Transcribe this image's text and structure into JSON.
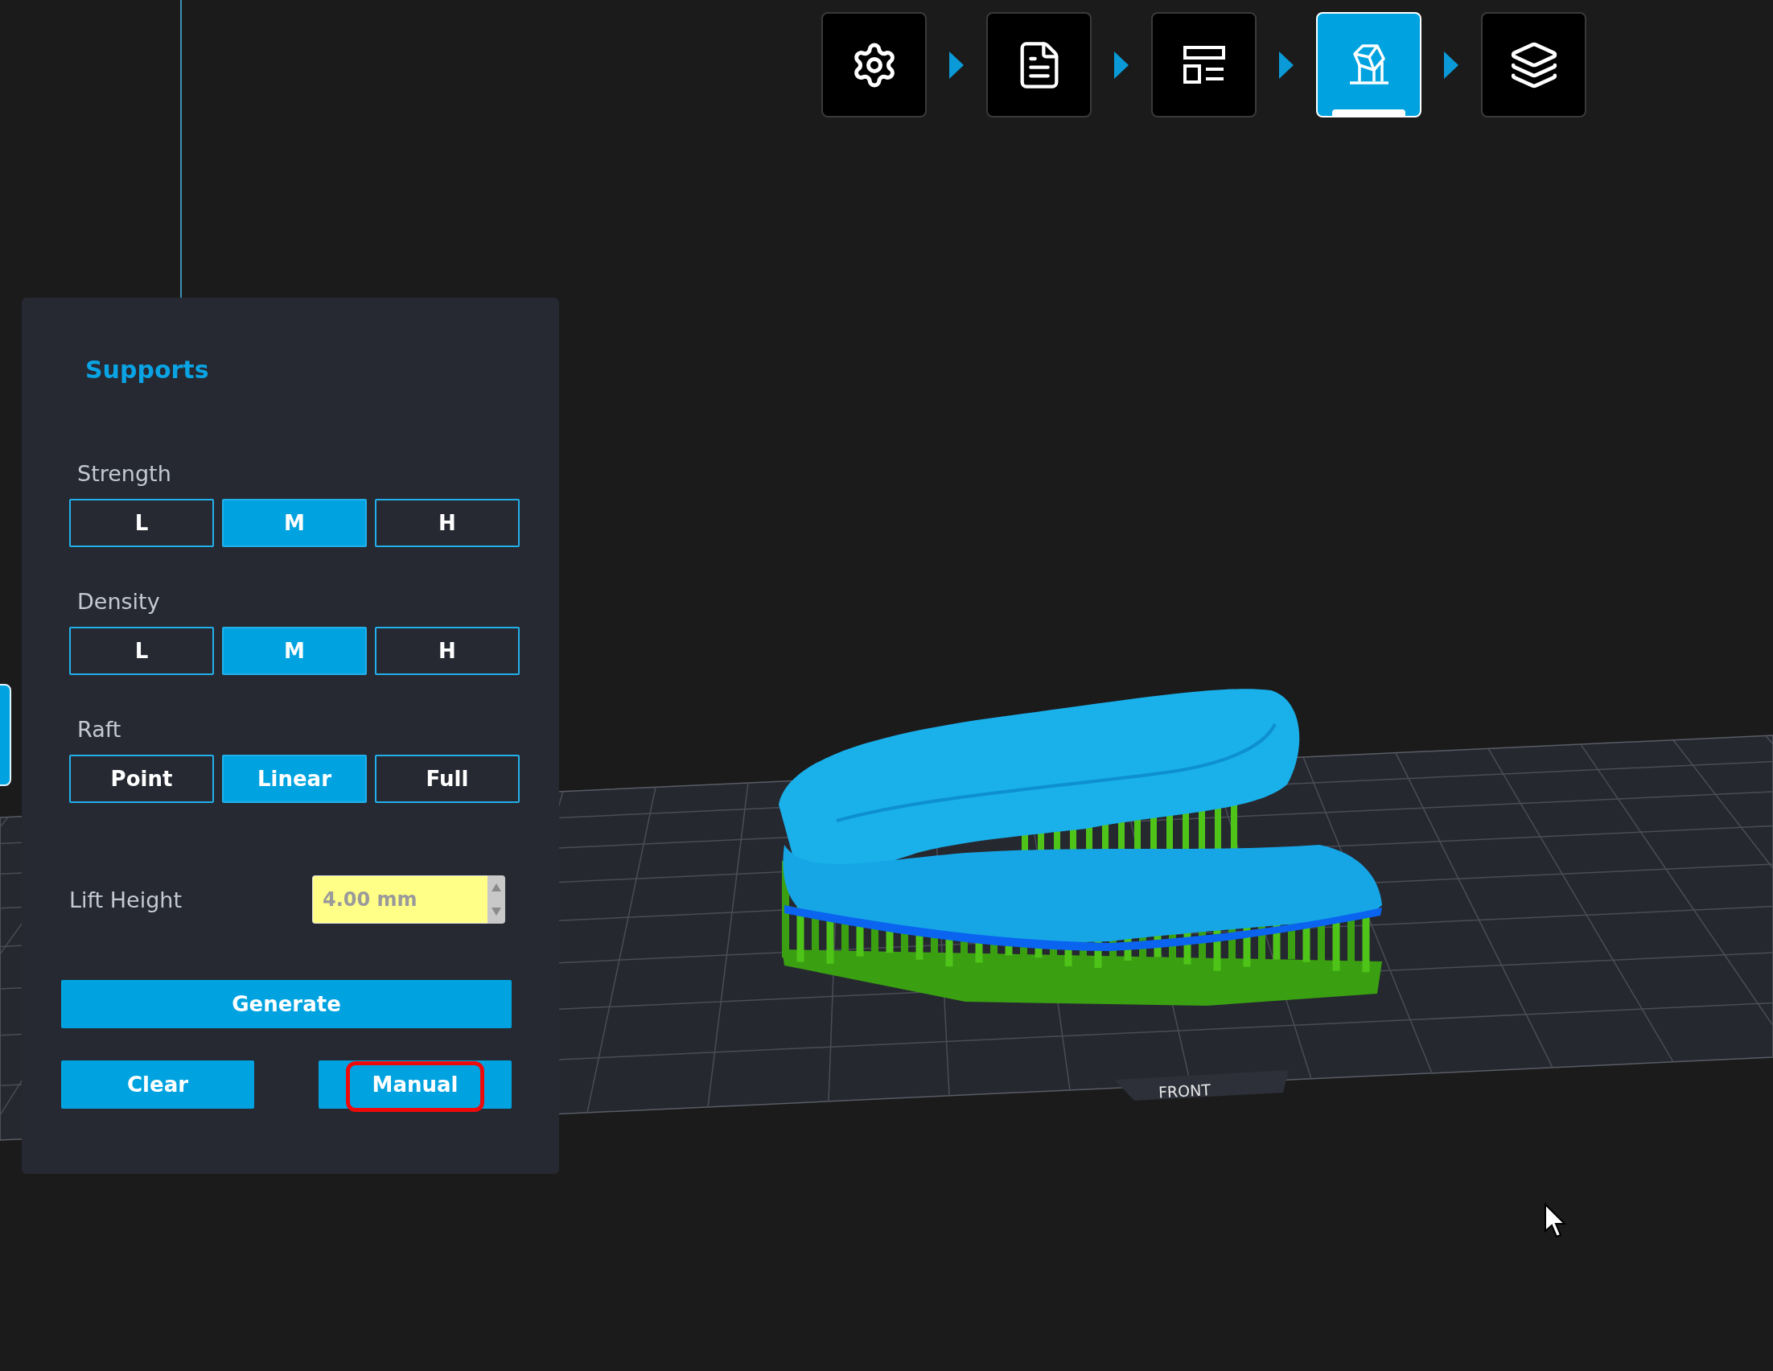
{
  "toolbar": {
    "steps": [
      {
        "kind": "settings",
        "selected": false
      },
      {
        "kind": "document",
        "selected": false
      },
      {
        "kind": "layout",
        "selected": false
      },
      {
        "kind": "supports",
        "selected": true
      },
      {
        "kind": "layers",
        "selected": false
      }
    ]
  },
  "panel": {
    "title": "Supports",
    "groups": [
      {
        "label": "Strength",
        "options": [
          {
            "label": "L",
            "selected": false
          },
          {
            "label": "M",
            "selected": true
          },
          {
            "label": "H",
            "selected": false
          }
        ]
      },
      {
        "label": "Density",
        "options": [
          {
            "label": "L",
            "selected": false
          },
          {
            "label": "M",
            "selected": true
          },
          {
            "label": "H",
            "selected": false
          }
        ]
      },
      {
        "label": "Raft",
        "options": [
          {
            "label": "Point",
            "selected": false
          },
          {
            "label": "Linear",
            "selected": true
          },
          {
            "label": "Full",
            "selected": false
          }
        ]
      }
    ],
    "lift_height": {
      "label": "Lift Height",
      "value": "4.00 mm"
    },
    "generate": {
      "label": "Generate"
    },
    "actions": [
      {
        "label": "Clear",
        "highlighted": false
      },
      {
        "label": "Manual",
        "highlighted": true
      }
    ]
  },
  "viewport": {
    "platform_label": "FRONT"
  }
}
